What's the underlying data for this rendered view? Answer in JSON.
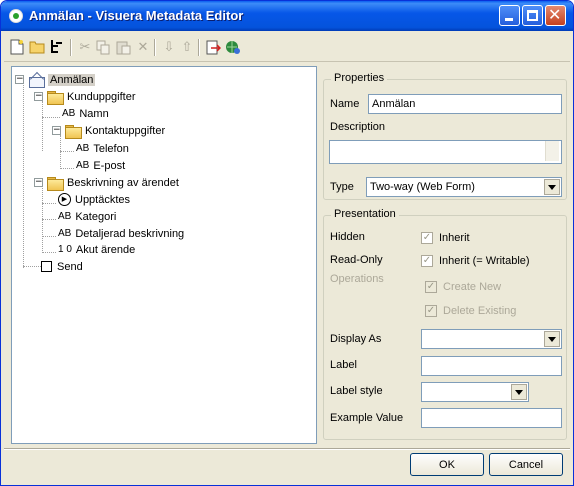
{
  "window": {
    "title": "Anmälan - Visuera Metadata Editor"
  },
  "titlebar_buttons": {
    "minimize": "minimize-icon",
    "maximize": "maximize-icon",
    "close": "close-icon"
  },
  "toolbar": {
    "tools": [
      "new-document-icon",
      "open-folder-icon",
      "tree-icon",
      "cut-icon",
      "copy-icon",
      "paste-icon",
      "delete-icon",
      "move-down-icon",
      "move-up-icon",
      "export-icon",
      "web-icon"
    ]
  },
  "tree": {
    "root": "Anmälan",
    "kunduppgifter": "Kunduppgifter",
    "namn": "Namn",
    "kontaktuppgifter": "Kontaktuppgifter",
    "telefon": "Telefon",
    "epost": "E-post",
    "beskrivning": "Beskrivning av ärendet",
    "upptacktes": "Upptäcktes",
    "kategori": "Kategori",
    "detaljerad": "Detaljerad beskrivning",
    "akut": "Akut ärende",
    "send": "Send",
    "glyph_text": "AB",
    "glyph_num": "1 0"
  },
  "properties": {
    "title": "Properties",
    "name_label": "Name",
    "name_value": "Anmälan",
    "description_label": "Description",
    "description_value": "",
    "type_label": "Type",
    "type_value": "Two-way (Web Form)"
  },
  "presentation": {
    "title": "Presentation",
    "hidden_label": "Hidden",
    "hidden_inherit": "Inherit",
    "readonly_label": "Read-Only",
    "readonly_inherit": "Inherit (= Writable)",
    "operations_label": "Operations",
    "create_new": "Create New",
    "delete_existing": "Delete Existing",
    "display_as_label": "Display As",
    "display_as_value": "",
    "label_label": "Label",
    "label_value": "",
    "label_style_label": "Label style",
    "label_style_value": "",
    "example_value_label": "Example Value",
    "example_value": ""
  },
  "buttons": {
    "ok": "OK",
    "cancel": "Cancel"
  }
}
